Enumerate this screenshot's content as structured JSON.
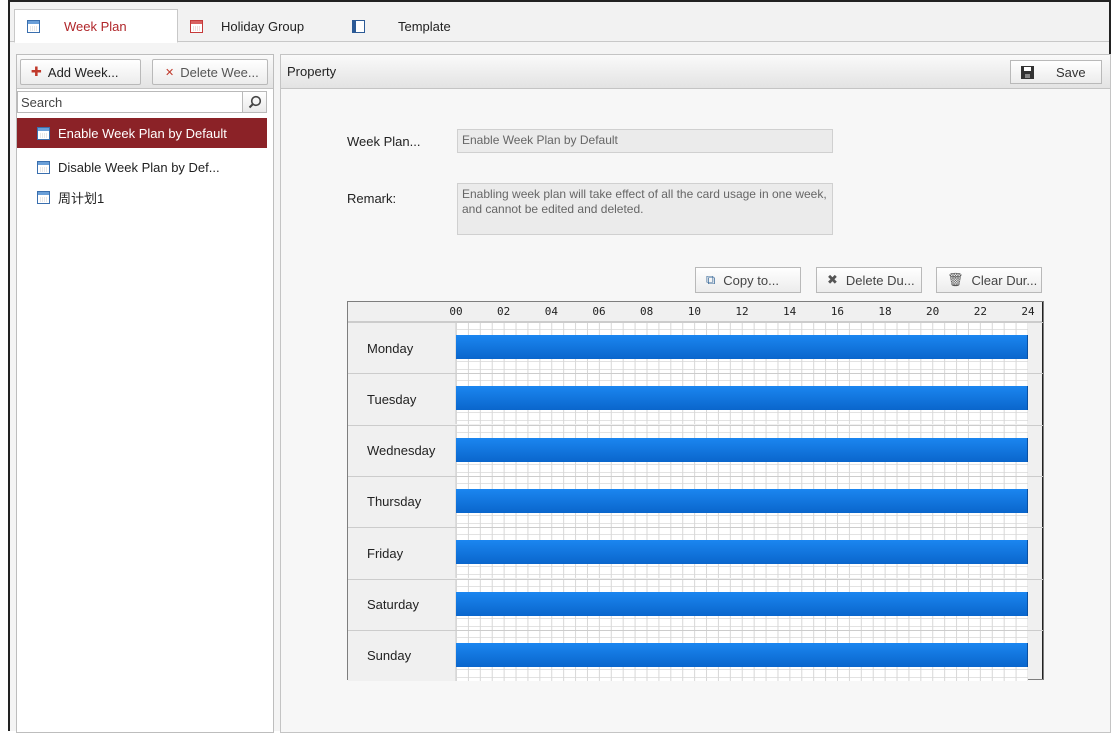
{
  "tabs": [
    {
      "label": "Week Plan",
      "icon": "calendar-icon",
      "active": true
    },
    {
      "label": "Holiday Group",
      "icon": "holiday-calendar-icon",
      "active": false
    },
    {
      "label": "Template",
      "icon": "template-icon",
      "active": false
    }
  ],
  "left": {
    "add_label": "Add Week...",
    "delete_label": "Delete Wee...",
    "search_placeholder": "Search",
    "items": [
      {
        "label": "Enable Week Plan by Default",
        "selected": true
      },
      {
        "label": "Disable Week Plan by Def...",
        "selected": false
      },
      {
        "label": "周计划1",
        "selected": false
      }
    ]
  },
  "property": {
    "title": "Property",
    "save_label": "Save",
    "name_label": "Week Plan...",
    "name_value": "Enable Week Plan by Default",
    "remark_label": "Remark:",
    "remark_value": "Enabling week plan will take effect of all the card usage in one week, and cannot be edited and deleted."
  },
  "actions": {
    "copy_label": "Copy to...",
    "delete_label": "Delete Du...",
    "clear_label": "Clear Dur..."
  },
  "schedule": {
    "hour_ticks": [
      "00",
      "02",
      "04",
      "06",
      "08",
      "10",
      "12",
      "14",
      "16",
      "18",
      "20",
      "22",
      "24"
    ],
    "days": [
      {
        "name": "Monday",
        "start": 0,
        "end": 24
      },
      {
        "name": "Tuesday",
        "start": 0,
        "end": 24
      },
      {
        "name": "Wednesday",
        "start": 0,
        "end": 24
      },
      {
        "name": "Thursday",
        "start": 0,
        "end": 24
      },
      {
        "name": "Friday",
        "start": 0,
        "end": 24
      },
      {
        "name": "Saturday",
        "start": 0,
        "end": 24
      },
      {
        "name": "Sunday",
        "start": 0,
        "end": 24
      }
    ],
    "bar_color": "#0f72dc",
    "selected_color": "#8b2227"
  }
}
